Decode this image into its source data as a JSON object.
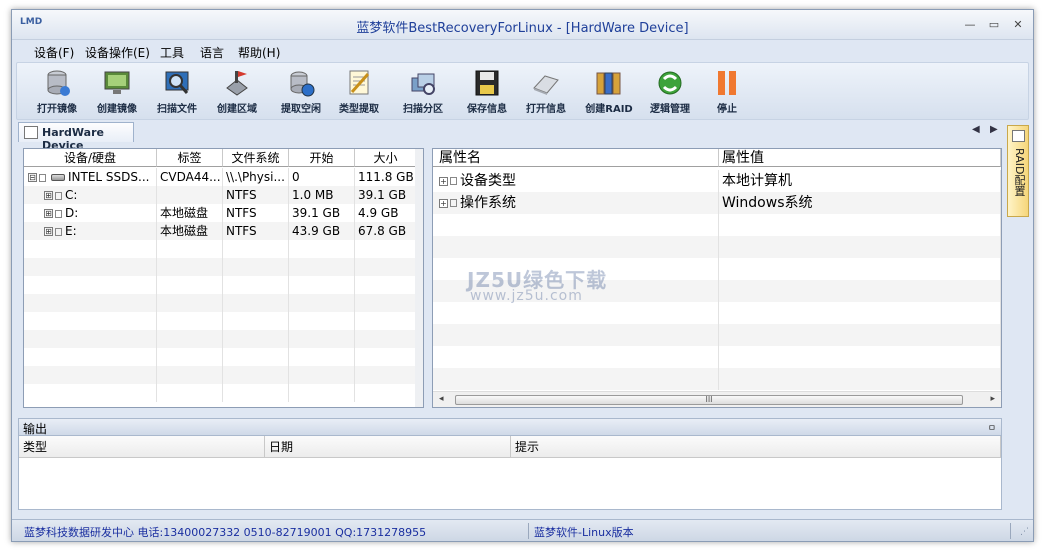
{
  "window": {
    "logo": "LMD",
    "title": "蓝梦软件BestRecoveryForLinux - [HardWare Device]",
    "minimize": "—",
    "restore": "▭",
    "close": "✕"
  },
  "menu": [
    "设备(F)",
    "设备操作(E)",
    "工具",
    "语言",
    "帮助(H)"
  ],
  "toolbar": [
    {
      "label": "打开镜像",
      "icon": "database-open-icon"
    },
    {
      "label": "创建镜像",
      "icon": "monitor-image-icon"
    },
    {
      "label": "扫描文件",
      "icon": "scan-file-icon"
    },
    {
      "label": "创建区域",
      "icon": "create-region-icon"
    },
    {
      "label": "提取空闲",
      "icon": "extract-free-icon"
    },
    {
      "label": "类型提取",
      "icon": "type-extract-icon"
    },
    {
      "label": "扫描分区",
      "icon": "scan-partition-icon"
    },
    {
      "label": "保存信息",
      "icon": "floppy-save-icon"
    },
    {
      "label": "打开信息",
      "icon": "open-info-icon"
    },
    {
      "label": "创建RAID",
      "icon": "raid-icon"
    },
    {
      "label": "逻辑管理",
      "icon": "logic-manage-icon"
    },
    {
      "label": "停止",
      "icon": "stop-icon"
    }
  ],
  "doc_tab": {
    "label": "HardWare Device"
  },
  "tab_nav": {
    "prev": "◀",
    "next": "▶"
  },
  "device_grid": {
    "headers": [
      "设备/硬盘",
      "标签",
      "文件系统",
      "开始",
      "大小"
    ],
    "rows": [
      {
        "name": "INTEL SSDS...",
        "tree": "⊟",
        "label": "CVDA44...",
        "fs": "\\\\.\\Physi...",
        "start": "0",
        "size": "111.8 GB"
      },
      {
        "name": "C:",
        "tree": "⊞",
        "label": "",
        "fs": "NTFS",
        "start": "1.0 MB",
        "size": "39.1 GB"
      },
      {
        "name": "D:",
        "tree": "⊞",
        "label": "本地磁盘",
        "fs": "NTFS",
        "start": "39.1 GB",
        "size": "4.9 GB"
      },
      {
        "name": "E:",
        "tree": "⊞",
        "label": "本地磁盘",
        "fs": "NTFS",
        "start": "43.9 GB",
        "size": "67.8 GB"
      }
    ]
  },
  "prop_grid": {
    "headers": [
      "属性名",
      "属性值"
    ],
    "rows": [
      {
        "name": "设备类型",
        "value": "本地计算机"
      },
      {
        "name": "操作系统",
        "value": "Windows系统"
      }
    ],
    "scroll_left": "◂",
    "scroll_right": "▸",
    "thumb_grip": "III"
  },
  "side_tab": {
    "label": "RAID配置"
  },
  "watermark": {
    "main": "JZ5U绿色下载",
    "sub": "www.jz5u.com"
  },
  "output": {
    "title": "输出",
    "pin": "ㅁ",
    "headers": [
      "类型",
      "日期",
      "提示"
    ]
  },
  "status": {
    "left": "蓝梦科技数据研发中心 电话:13400027332  0510-82719001  QQ:1731278955",
    "right": "蓝梦软件-Linux版本",
    "grip": "⋰"
  }
}
